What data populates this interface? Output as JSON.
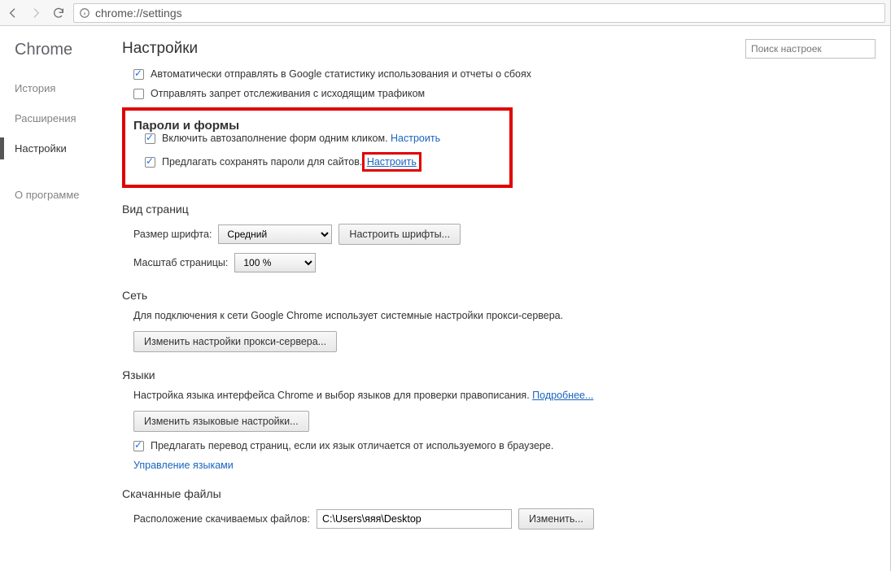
{
  "address_bar": {
    "url": "chrome://settings"
  },
  "sidebar": {
    "brand": "Chrome",
    "items": [
      {
        "label": "История"
      },
      {
        "label": "Расширения"
      },
      {
        "label": "Настройки"
      }
    ],
    "about": "О программе"
  },
  "header": {
    "title": "Настройки",
    "search_placeholder": "Поиск настроек"
  },
  "privacy_tail": {
    "send_stats": "Автоматически отправлять в Google статистику использования и отчеты о сбоях",
    "dnt": "Отправлять запрет отслеживания с исходящим трафиком"
  },
  "passwords": {
    "heading": "Пароли и формы",
    "autofill": "Включить автозаполнение форм одним кликом.",
    "autofill_link": "Настроить",
    "save_pw": "Предлагать сохранять пароли для сайтов.",
    "save_pw_link": "Настроить"
  },
  "appearance": {
    "heading": "Вид страниц",
    "font_size_label": "Размер шрифта:",
    "font_size_value": "Средний",
    "customize_fonts": "Настроить шрифты...",
    "zoom_label": "Масштаб страницы:",
    "zoom_value": "100 %"
  },
  "network": {
    "heading": "Сеть",
    "desc": "Для подключения к сети Google Chrome использует системные настройки прокси-сервера.",
    "proxy_btn": "Изменить настройки прокси-сервера..."
  },
  "languages": {
    "heading": "Языки",
    "desc_pre": "Настройка языка интерфейса Chrome и выбор языков для проверки правописания.",
    "more": "Подробнее...",
    "btn": "Изменить языковые настройки...",
    "translate": "Предлагать перевод страниц, если их язык отличается от используемого в браузере.",
    "manage": "Управление языками"
  },
  "downloads": {
    "heading": "Скачанные файлы",
    "loc_label": "Расположение скачиваемых файлов:",
    "loc_value": "C:\\Users\\яяя\\Desktop",
    "change": "Изменить..."
  }
}
